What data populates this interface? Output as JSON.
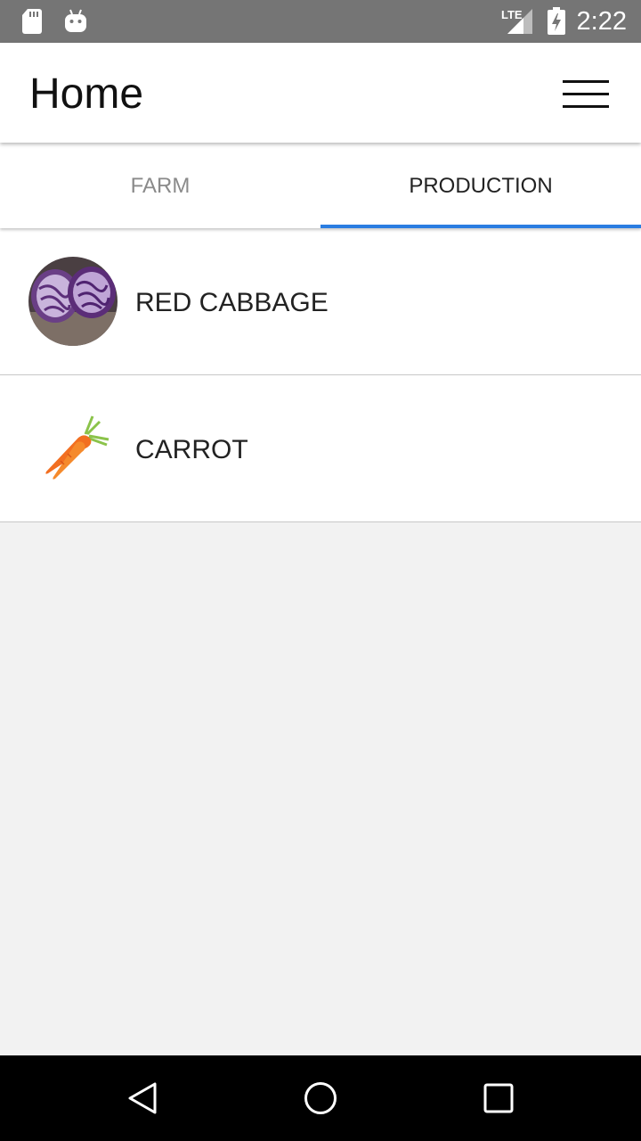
{
  "status_bar": {
    "time": "2:22",
    "network": "LTE",
    "icons": [
      "sd-card-icon",
      "android-icon",
      "lte-signal-icon",
      "battery-charging-icon"
    ]
  },
  "app_bar": {
    "title": "Home",
    "menu_icon": "hamburger-menu-icon"
  },
  "tabs": [
    {
      "label": "FARM",
      "selected": false
    },
    {
      "label": "PRODUCTION",
      "selected": true
    }
  ],
  "list": {
    "items": [
      {
        "label": "RED CABBAGE",
        "thumbnail": "red-cabbage-image"
      },
      {
        "label": "CARROT",
        "thumbnail": "carrot-image"
      }
    ]
  },
  "nav_bar": {
    "icons": [
      "back-icon",
      "home-icon",
      "recents-icon"
    ]
  },
  "colors": {
    "status_bar": "#757575",
    "accent": "#2a7de1",
    "background": "#f2f2f2",
    "tab_inactive": "#8a8a8a"
  }
}
